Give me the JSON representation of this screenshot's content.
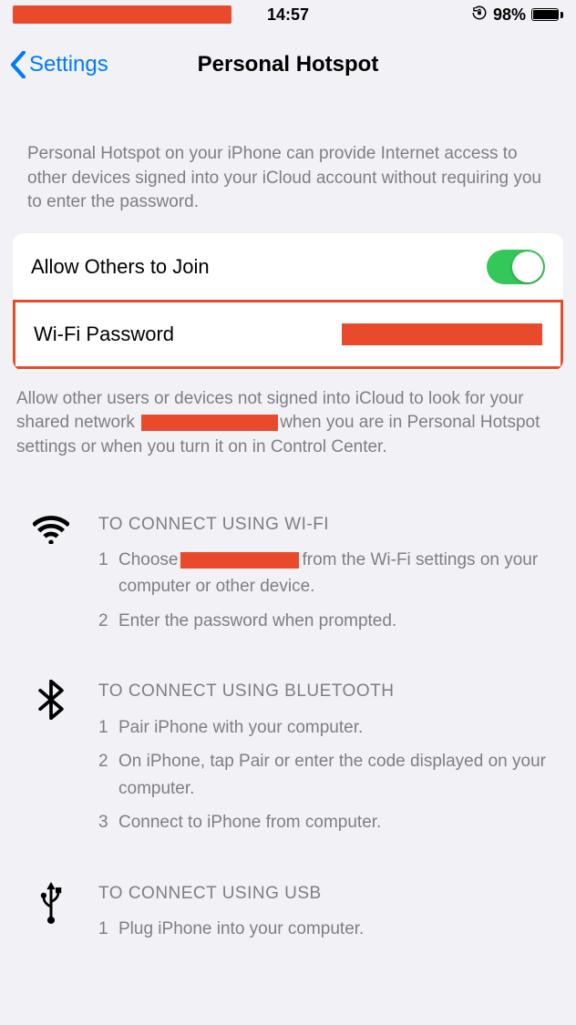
{
  "status": {
    "time": "14:57",
    "battery_pct": "98%"
  },
  "nav": {
    "back": "Settings",
    "title": "Personal Hotspot"
  },
  "hero": "Personal Hotspot on your iPhone can provide Internet access to other devices signed into your iCloud account without requiring you to enter the password.",
  "rows": {
    "allow_label": "Allow Others to Join",
    "wifi_pw_label": "Wi-Fi Password"
  },
  "footer_a": "Allow other users or devices not signed into iCloud to look for your shared network ",
  "footer_b": "when you are in Personal Hotspot settings or when you turn it on in Control Center.",
  "wifi": {
    "title": "TO CONNECT USING WI-FI",
    "s1a": "Choose",
    "s1b": "from the Wi-Fi settings on your computer or other device.",
    "s2": "Enter the password when prompted."
  },
  "bt": {
    "title": "TO CONNECT USING BLUETOOTH",
    "s1": "Pair iPhone with your computer.",
    "s2": "On iPhone, tap Pair or enter the code displayed on your computer.",
    "s3": "Connect to iPhone from computer."
  },
  "usb": {
    "title": "TO CONNECT USING USB",
    "s1": "Plug iPhone into your computer."
  },
  "n": {
    "n1": "1",
    "n2": "2",
    "n3": "3"
  }
}
